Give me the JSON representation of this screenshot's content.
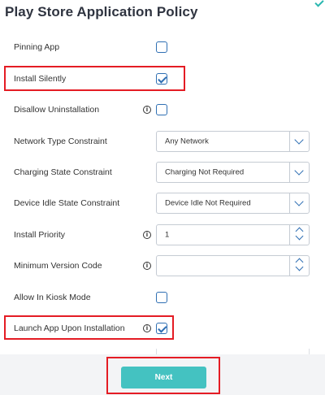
{
  "title": "Play Store Application Policy",
  "fields": {
    "pinning_app": {
      "label": "Pinning App",
      "checked": false
    },
    "install_silently": {
      "label": "Install Silently",
      "checked": true
    },
    "disallow_uninstallation": {
      "label": "Disallow Uninstallation",
      "checked": false,
      "info": "i"
    },
    "network_type": {
      "label": "Network Type Constraint",
      "value": "Any Network"
    },
    "charging_state": {
      "label": "Charging State Constraint",
      "value": "Charging Not Required"
    },
    "device_idle": {
      "label": "Device Idle State Constraint",
      "value": "Device Idle Not Required"
    },
    "install_priority": {
      "label": "Install Priority",
      "value": "1",
      "info": "i"
    },
    "minimum_version": {
      "label": "Minimum Version Code",
      "value": "",
      "info": "i"
    },
    "allow_kiosk": {
      "label": "Allow In Kiosk Mode",
      "checked": false
    },
    "launch_app": {
      "label": "Launch App Upon Installation",
      "checked": true,
      "info": "i"
    }
  },
  "footer": {
    "next_label": "Next"
  },
  "colors": {
    "accent": "#2f6fb3",
    "button": "#44c2c1",
    "highlight": "#e41c24",
    "title": "#2f3440"
  }
}
